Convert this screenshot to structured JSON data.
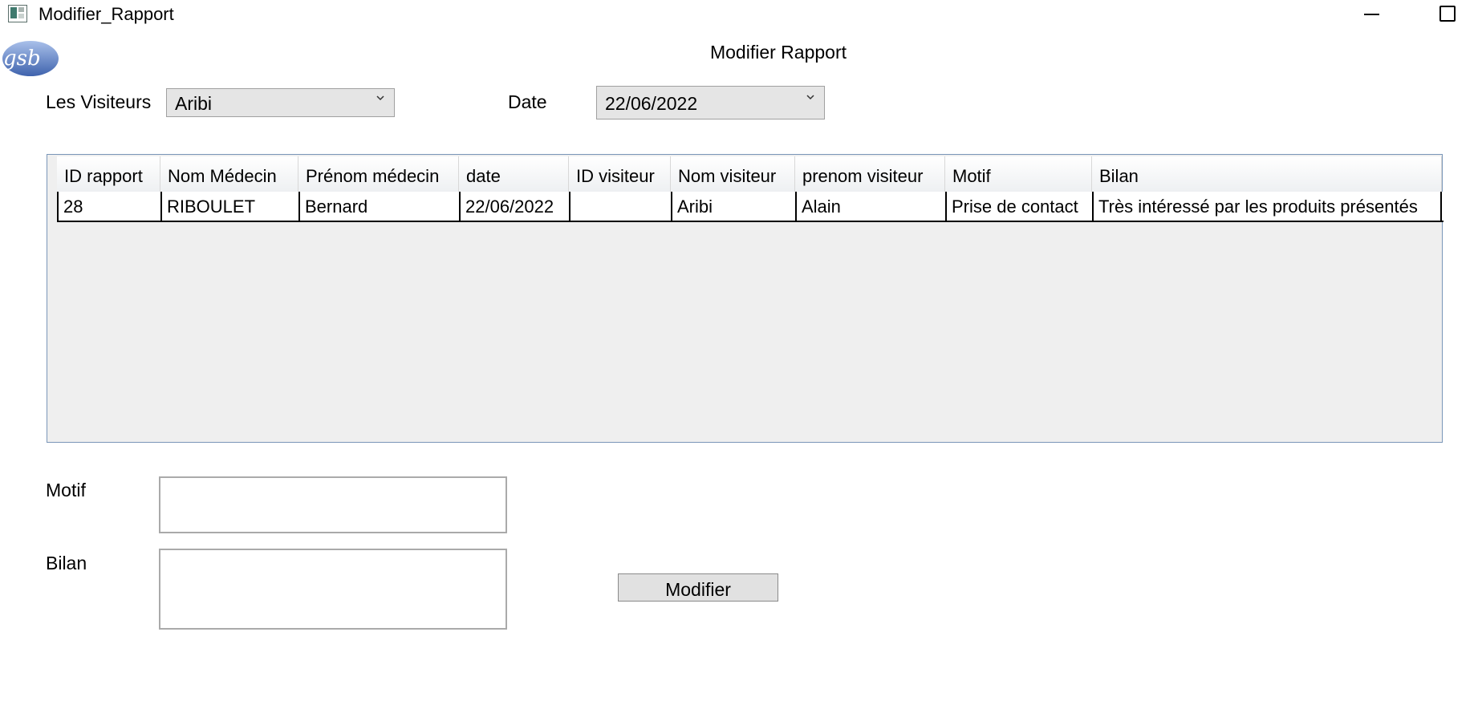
{
  "window": {
    "title": "Modifier_Rapport"
  },
  "header": {
    "title": "Modifier Rapport",
    "logo_text": "gsb"
  },
  "filters": {
    "visiteurs_label": "Les Visiteurs",
    "visiteurs_selected": "Aribi",
    "date_label": "Date",
    "date_selected": "22/06/2022"
  },
  "grid": {
    "columns": [
      "ID rapport",
      "Nom Médecin",
      "Prénom médecin",
      "date",
      "ID visiteur",
      "Nom visiteur",
      "prenom visiteur",
      "Motif",
      "Bilan"
    ],
    "rows": [
      [
        "28",
        "RIBOULET",
        "Bernard",
        "22/06/2022",
        "",
        "Aribi",
        "Alain",
        "Prise de contact",
        "Très intéressé par les produits présentés"
      ]
    ]
  },
  "form": {
    "motif_label": "Motif",
    "motif_value": "",
    "bilan_label": "Bilan",
    "bilan_value": "",
    "submit_label": "Modifier"
  },
  "colors": {
    "grid_border": "#7a96b8",
    "grid_background": "#efefef",
    "button_background": "#e1e1e1",
    "logo_blue": "#5b7fc0"
  }
}
